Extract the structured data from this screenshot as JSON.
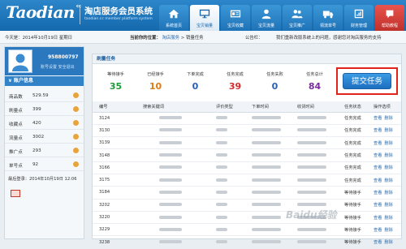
{
  "header": {
    "logo": "Taodian",
    "logo_sup": "cc",
    "title": "淘店服务会员系统",
    "subtitle": "taodian.cc member platform system"
  },
  "nav": [
    {
      "label": "系统首页",
      "icon": "home-icon",
      "active": false
    },
    {
      "label": "宝贝销量",
      "icon": "monitor-icon",
      "active": true
    },
    {
      "label": "宝贝收藏",
      "icon": "id-card-icon",
      "active": false
    },
    {
      "label": "宝贝流量",
      "icon": "user-icon",
      "active": false
    },
    {
      "label": "宝贝推广",
      "icon": "user-group-icon",
      "active": false
    },
    {
      "label": "领流单号",
      "icon": "truck-icon",
      "active": false
    },
    {
      "label": "财务管理",
      "icon": "finance-icon",
      "active": false
    },
    {
      "label": "帮助教程",
      "icon": "help-icon",
      "active": false
    }
  ],
  "infobar": {
    "today": "今天是：2014年10月19日 星期日",
    "crumb_prefix": "当前你的位置：",
    "crumb_link": "淘店服务",
    "crumb_current": "> 销量任务",
    "notice_label": "公告栏：",
    "notice_text": "我们重新改版系统上的问题，感谢您对淘店服务的支持"
  },
  "sidebar": {
    "user_id": "958800797",
    "links": "账号设置   安全退出",
    "account_title": "账户信息",
    "rows": [
      {
        "k": "商品数",
        "v": "529.59"
      },
      {
        "k": "刷量点",
        "v": "399"
      },
      {
        "k": "收藏点",
        "v": "420"
      },
      {
        "k": "流量点",
        "v": "3002"
      },
      {
        "k": "推广点",
        "v": "293"
      },
      {
        "k": "单号点",
        "v": "92"
      }
    ],
    "last_login": "最后登录：2014年10月19日 12:06"
  },
  "main": {
    "title": "刷量任务",
    "stats": [
      {
        "label": "等待接手",
        "value": "35",
        "color": "#1e9a3a"
      },
      {
        "label": "已经接手",
        "value": "10",
        "color": "#e07b12"
      },
      {
        "label": "下单完成",
        "value": "0",
        "color": "#2a5fb3"
      },
      {
        "label": "任务完成",
        "value": "39",
        "color": "#d32b2b"
      },
      {
        "label": "任务失败",
        "value": "0",
        "color": "#2a5fb3"
      },
      {
        "label": "任务总计",
        "value": "84",
        "color": "#7b2c9e"
      }
    ],
    "submit_label": "提交任务",
    "columns": [
      "编号",
      "搜索关键词",
      "评价类型",
      "下单时间",
      "收货时间",
      "任务状态",
      "操作选项"
    ],
    "rows": [
      {
        "id": "3124",
        "status": "任务完成"
      },
      {
        "id": "3130",
        "status": "任务完成"
      },
      {
        "id": "3139",
        "status": "任务完成"
      },
      {
        "id": "3148",
        "status": "任务完成"
      },
      {
        "id": "3166",
        "status": "任务完成"
      },
      {
        "id": "3175",
        "status": "任务完成"
      },
      {
        "id": "3184",
        "status": "等待接手"
      },
      {
        "id": "3202",
        "status": "等待接手"
      },
      {
        "id": "3220",
        "status": "等待接手"
      },
      {
        "id": "3229",
        "status": "等待接手"
      },
      {
        "id": "3238",
        "status": "等待接手"
      }
    ],
    "op_view": "查看",
    "op_delete": "删除"
  },
  "watermark": "Baidu经验"
}
